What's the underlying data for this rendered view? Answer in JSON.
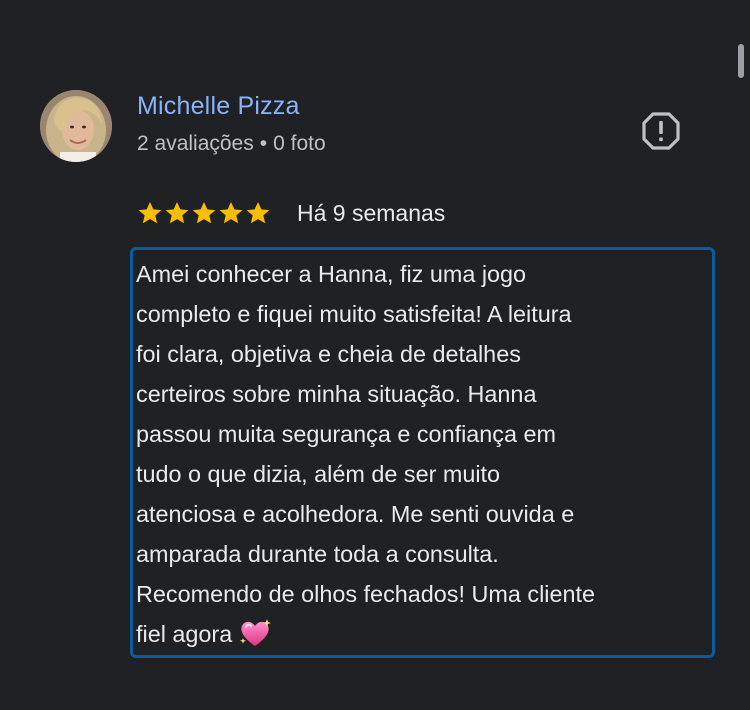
{
  "reviewer": {
    "name": "Michelle Pizza",
    "reviews_count": "2 avaliações",
    "separator": "•",
    "photos_count": "0 foto"
  },
  "report_icon": "report-flag-icon",
  "rating": {
    "stars": 5,
    "max_stars": 5,
    "star_color": "#fbbc04",
    "date": "Há 9 semanas"
  },
  "review": {
    "lines": [
      "Amei conhecer a Hanna, fiz uma jogo",
      "completo e fiquei muito satisfeita! A leitura",
      "foi clara, objetiva e cheia de detalhes",
      "certeiros sobre minha situação. Hanna",
      "passou muita segurança e confiança em",
      "tudo o que dizia, além de ser muito",
      "atenciosa e acolhedora. Me senti ouvida e",
      "amparada durante toda a consulta.",
      "Recomendo de olhos fechados! Uma cliente",
      "fiel agora"
    ],
    "emoji": "sparkling-heart-emoji"
  },
  "colors": {
    "background": "#202124",
    "name": "#8ab4f8",
    "meta": "#bdc1c6",
    "text": "#e8eaed",
    "highlight_border": "#0e5aa0"
  }
}
